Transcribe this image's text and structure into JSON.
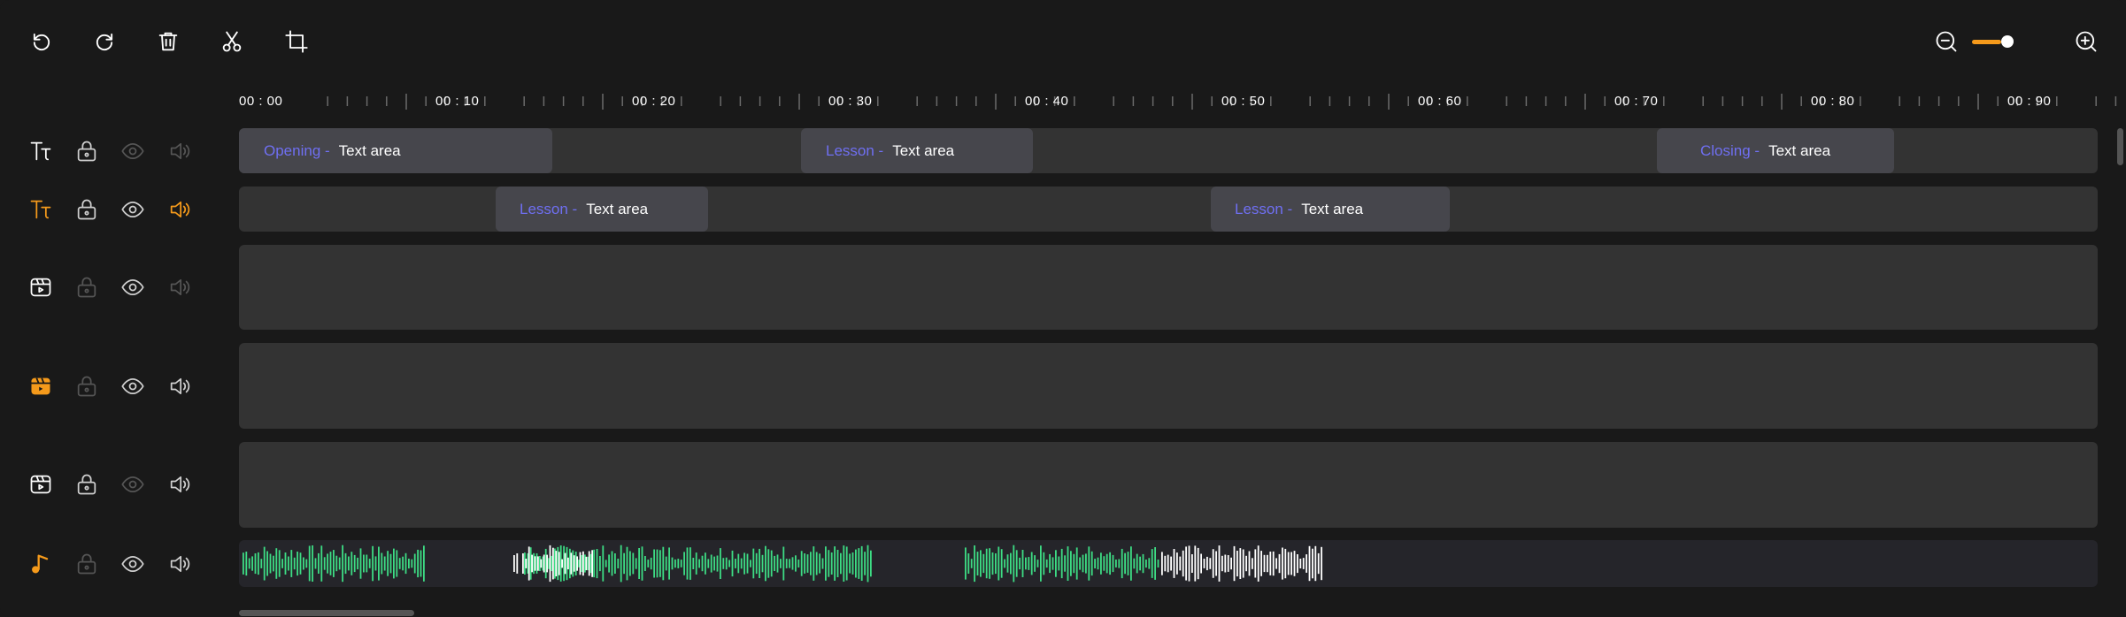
{
  "toolbar": {
    "left_tools": [
      {
        "name": "undo-button",
        "icon": "undo-icon"
      },
      {
        "name": "redo-button",
        "icon": "redo-icon"
      },
      {
        "name": "delete-button",
        "icon": "trash-icon"
      },
      {
        "name": "split-button",
        "icon": "scissors-icon"
      },
      {
        "name": "crop-button",
        "icon": "crop-icon"
      }
    ],
    "zoom": {
      "level": 0.75
    }
  },
  "ruler": {
    "labels": [
      "00 : 00",
      "00 : 10",
      "00 : 20",
      "00 : 30",
      "00 : 40",
      "00 : 50",
      "00 : 60",
      "00 : 70",
      "00 : 80",
      "00 : 90"
    ]
  },
  "tracks": [
    {
      "type": "text",
      "icon": "text-track-icon",
      "active": false,
      "clips": [
        {
          "tag": "Opening -",
          "text": "Text area"
        },
        {
          "tag": "Lesson -",
          "text": "Text area"
        },
        {
          "tag": "Closing -",
          "text": "Text area"
        }
      ]
    },
    {
      "type": "text",
      "icon": "text-track-icon",
      "active": true,
      "clips": [
        {
          "tag": "Lesson -",
          "text": "Text area"
        },
        {
          "tag": "Lesson -",
          "text": "Text area"
        }
      ]
    },
    {
      "type": "video",
      "icon": "video-track-icon",
      "active": false,
      "clips": []
    },
    {
      "type": "video",
      "icon": "video-track-icon",
      "active": true,
      "clips": []
    },
    {
      "type": "video",
      "icon": "video-track-icon",
      "active": false,
      "clips": []
    },
    {
      "type": "audio",
      "icon": "music-track-icon",
      "active": true,
      "clips": []
    }
  ],
  "colors": {
    "accent": "#f59a1b",
    "clip_tag": "#6f6ff2",
    "waveform_green": "#3ddc84",
    "waveform_white": "#ffffff"
  }
}
